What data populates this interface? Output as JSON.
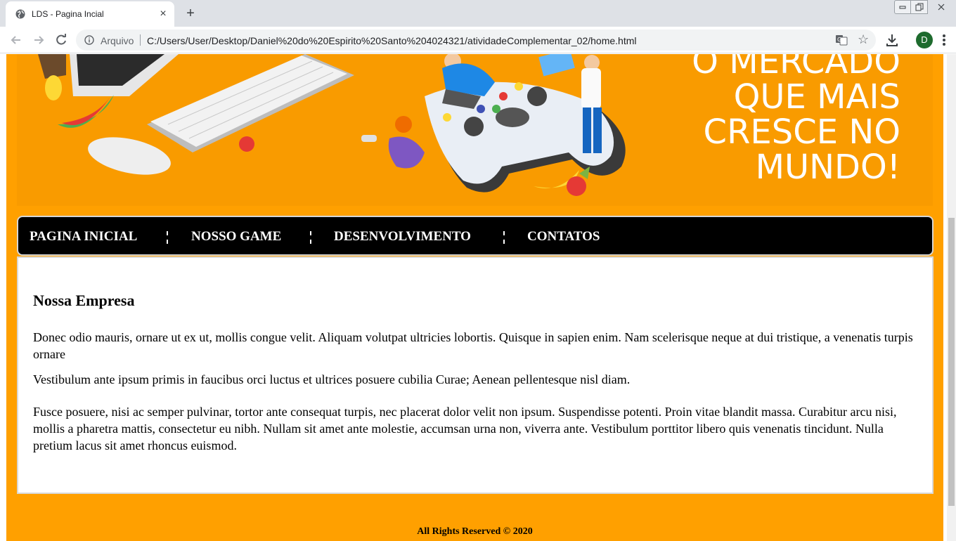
{
  "browser": {
    "tab_title": "LDS - Pagina Incial",
    "tab_close": "×",
    "new_tab": "+",
    "omnibox_scheme": "Arquivo",
    "url": "C:/Users/User/Desktop/Daniel%20do%20Espirito%20Santo%204024321/atividadeComplementar_02/home.html",
    "profile_initial": "D",
    "star": "☆"
  },
  "hero": {
    "text_lines": [
      "O MERCADO",
      "QUE MAIS",
      "CRESCE NO",
      "MUNDO!"
    ],
    "background_color": "#f99b00"
  },
  "nav": {
    "items": [
      "PAGINA INICIAL",
      "NOSSO GAME",
      "DESENVOLVIMENTO",
      "CONTATOS"
    ],
    "separator": "¦"
  },
  "content": {
    "heading": "Nossa Empresa",
    "paragraphs": [
      "Donec odio mauris, ornare ut ex ut, mollis congue velit. Aliquam volutpat ultricies lobortis. Quisque in sapien enim. Nam scelerisque neque at dui tristique, a venenatis turpis ornare",
      "Vestibulum ante ipsum primis in faucibus orci luctus et ultrices posuere cubilia Curae; Aenean pellentesque nisl diam.",
      "Fusce posuere, nisi ac semper pulvinar, tortor ante consequat turpis, nec placerat dolor velit non ipsum. Suspendisse potenti. Proin vitae blandit massa. Curabitur arcu nisi, mollis a pharetra mattis, consectetur eu nibh. Nullam sit amet ante molestie, accumsan urna non, viverra ante. Vestibulum porttitor libero quis venenatis tincidunt. Nulla pretium lacus sit amet rhoncus euismod."
    ]
  },
  "footer": {
    "text": "All Rights Reserved © 2020"
  },
  "colors": {
    "page_background": "#ffa000",
    "nav_background": "#000000",
    "profile_avatar": "#1e6b2e"
  }
}
